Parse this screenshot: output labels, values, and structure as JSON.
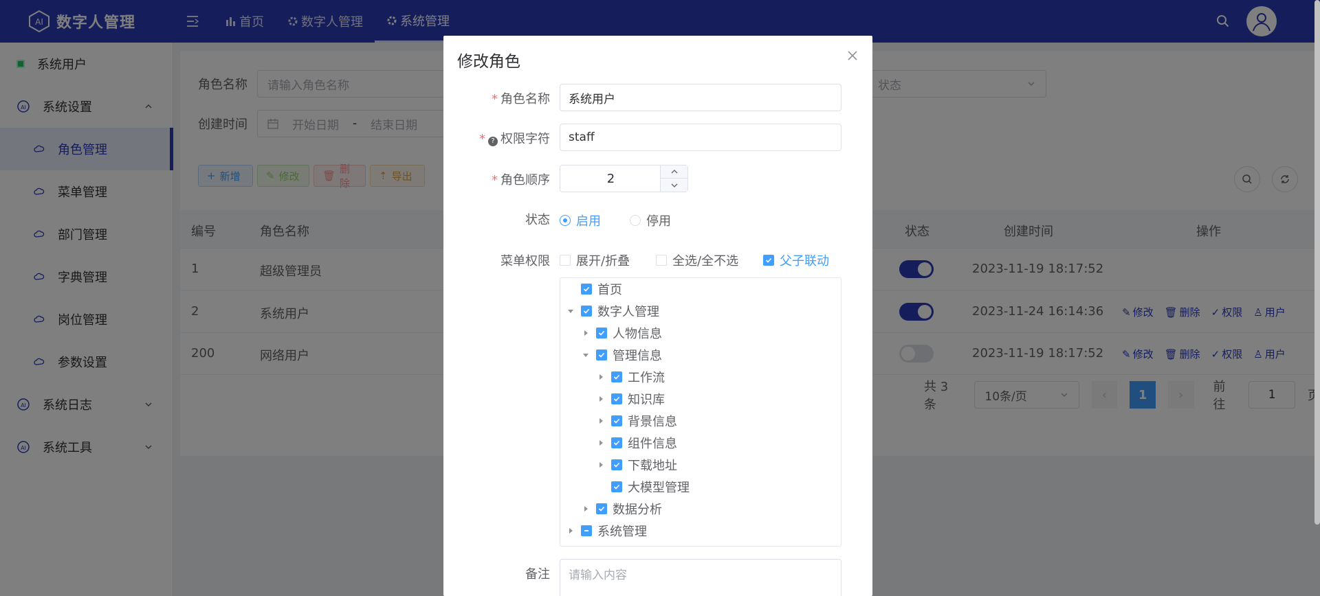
{
  "app": {
    "title": "数字人管理"
  },
  "topnav": [
    {
      "label": "首页",
      "icon": "bar-chart-icon"
    },
    {
      "label": "数字人管理",
      "icon": "gear-icon"
    },
    {
      "label": "系统管理",
      "icon": "gear-icon"
    }
  ],
  "sidebar": {
    "system_user": "系统用户",
    "settings": "系统设置",
    "sub_items": [
      "角色管理",
      "菜单管理",
      "部门管理",
      "字典管理",
      "岗位管理",
      "参数设置"
    ],
    "logs": "系统日志",
    "tools": "系统工具"
  },
  "filters": {
    "role_name_label": "角色名称",
    "role_name_placeholder": "请输入角色名称",
    "status_placeholder": "状态",
    "created_label": "创建时间",
    "start_date": "开始日期",
    "date_sep": "-",
    "end_date": "结束日期"
  },
  "toolbar": {
    "add": "新增",
    "edit": "修改",
    "delete": "删除",
    "export": "导出"
  },
  "table": {
    "headers": {
      "id": "编号",
      "name": "角色名称",
      "status": "状态",
      "created": "创建时间",
      "actions": "操作"
    },
    "rows": [
      {
        "id": "1",
        "name": "超级管理员",
        "enabled": true,
        "created": "2023-11-19 18:17:52"
      },
      {
        "id": "2",
        "name": "系统用户",
        "enabled": true,
        "created": "2023-11-24 16:14:36"
      },
      {
        "id": "200",
        "name": "网络用户",
        "enabled": false,
        "created": "2023-11-19 18:17:52"
      }
    ],
    "actions": {
      "edit": "修改",
      "delete": "删除",
      "perm": "权限",
      "user": "用户"
    }
  },
  "pager": {
    "total": "共 3 条",
    "size": "10条/页",
    "current": "1",
    "goto": "前往",
    "goto_value": "1",
    "page_suffix": "页"
  },
  "dialog": {
    "title": "修改角色",
    "role_name_label": "角色名称",
    "role_name_value": "系统用户",
    "perm_key_label": "权限字符",
    "perm_key_value": "staff",
    "order_label": "角色顺序",
    "order_value": "2",
    "status_label": "状态",
    "status_on": "启用",
    "status_off": "停用",
    "menu_perm_label": "菜单权限",
    "expand": "展开/折叠",
    "select_all": "全选/全不选",
    "linkage": "父子联动",
    "tree": [
      "首页",
      "数字人管理",
      "人物信息",
      "管理信息",
      "工作流",
      "知识库",
      "背景信息",
      "组件信息",
      "下载地址",
      "大模型管理",
      "数据分析",
      "系统管理"
    ],
    "remark_label": "备注",
    "remark_placeholder": "请输入内容"
  },
  "colors": {
    "primary": "#2a3bb5",
    "accent": "#409eff"
  }
}
